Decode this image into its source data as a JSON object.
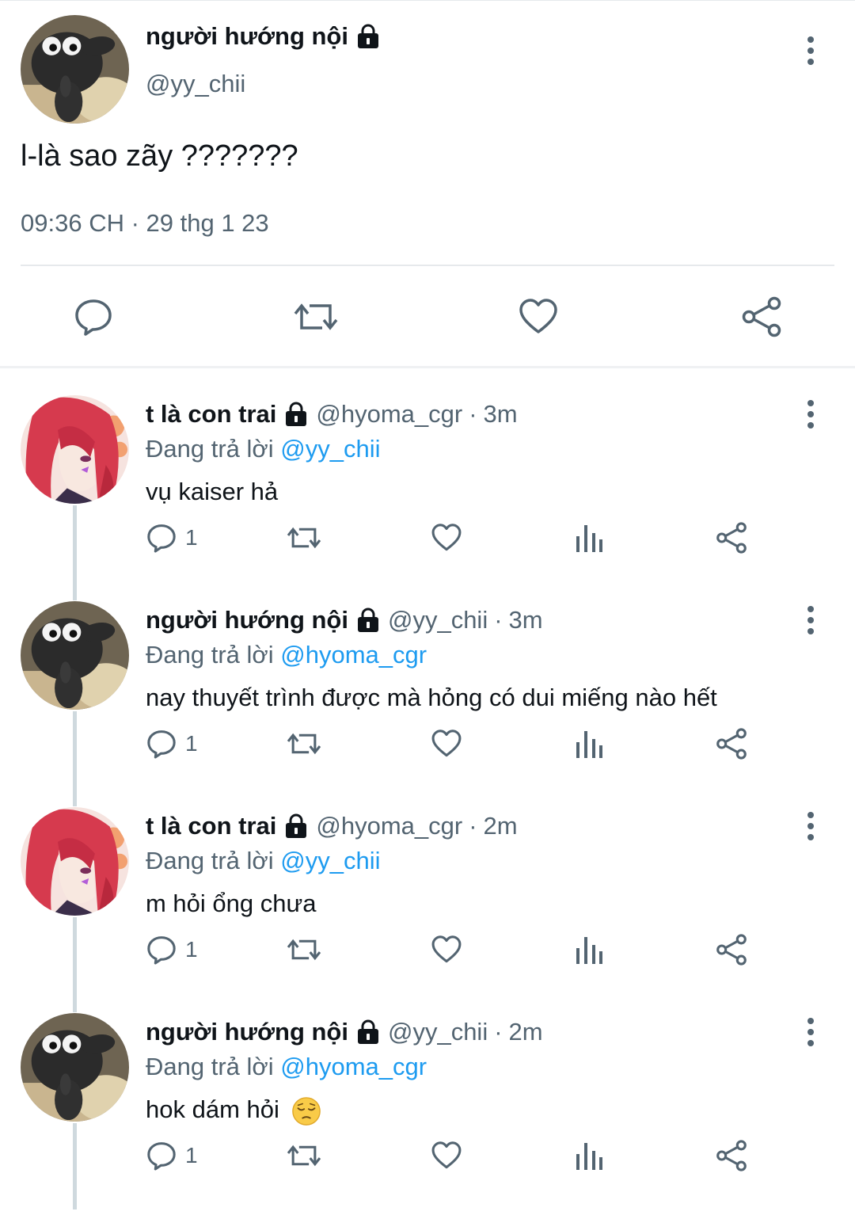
{
  "main_tweet": {
    "author_name": "người hướng nội",
    "author_handle": "@yy_chii",
    "text": "l-là sao zãy ???????",
    "timestamp": "09:36 CH · 29 thg 1 23",
    "actions": [
      "reply-icon",
      "retweet-icon",
      "like-icon",
      "share-icon"
    ]
  },
  "replies": [
    {
      "author_name": "t là con trai",
      "author_handle": "@hyoma_cgr",
      "separator": "·",
      "time": "3m",
      "replying_prefix": "Đang trả lời",
      "replying_to": "@yy_chii",
      "text": "vụ kaiser hả",
      "reply_count": "1",
      "avatar": "red-hair-anime-avatar"
    },
    {
      "author_name": "người hướng nội",
      "author_handle": "@yy_chii",
      "separator": "·",
      "time": "3m",
      "replying_prefix": "Đang trả lời",
      "replying_to": "@hyoma_cgr",
      "text": "nay thuyết trình được mà hỏng có dui miếng nào hết",
      "reply_count": "1",
      "avatar": "sheep-avatar"
    },
    {
      "author_name": "t là con trai",
      "author_handle": "@hyoma_cgr",
      "separator": "·",
      "time": "2m",
      "replying_prefix": "Đang trả lời",
      "replying_to": "@yy_chii",
      "text": "m hỏi ổng chưa",
      "reply_count": "1",
      "avatar": "red-hair-anime-avatar"
    },
    {
      "author_name": "người hướng nội",
      "author_handle": "@yy_chii",
      "separator": "·",
      "time": "2m",
      "replying_prefix": "Đang trả lời",
      "replying_to": "@hyoma_cgr",
      "text": "hok dám hỏi",
      "text_emoji": "pensive-face-emoji",
      "reply_count": "1",
      "avatar": "sheep-avatar"
    }
  ],
  "colors": {
    "text_primary": "#0f1419",
    "text_secondary": "#536471",
    "mention": "#1d9bf0",
    "divider": "#e6e9ec",
    "thread_line": "#cfd9de"
  }
}
